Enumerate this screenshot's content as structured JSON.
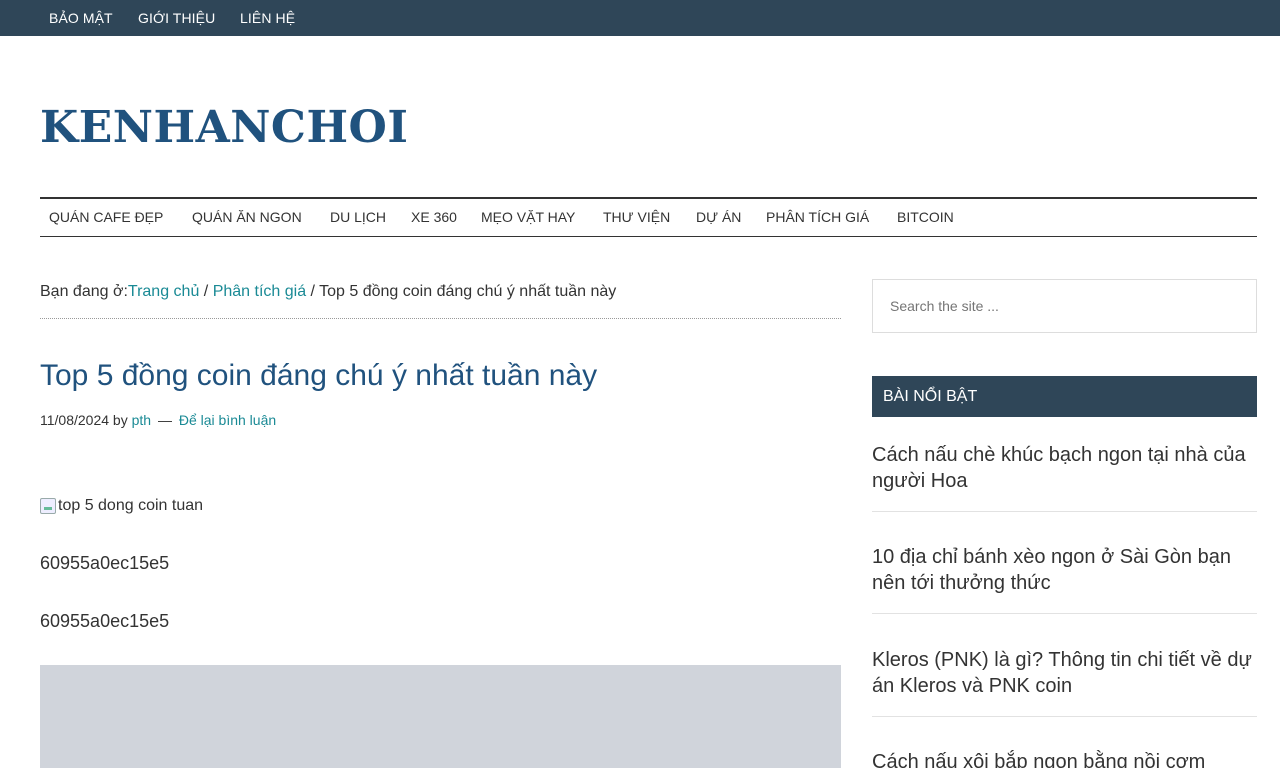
{
  "top_menu": [
    "BẢO MẬT",
    "GIỚI THIỆU",
    "LIÊN HỆ"
  ],
  "site_title": "KENHANCHOI",
  "main_menu": [
    "QUÁN CAFE ĐẸP",
    "QUÁN ĂN NGON",
    "DU LỊCH",
    "XE 360",
    "MẸO VẶT HAY",
    "THƯ VIỆN",
    "DỰ ÁN",
    "PHÂN TÍCH GIÁ",
    "BITCOIN"
  ],
  "breadcrumb": {
    "prefix": "Bạn đang ở:",
    "home": "Trang chủ",
    "sep1": " / ",
    "category": "Phân tích giá",
    "sep2": " / ",
    "current": "Top 5 đồng coin đáng chú ý nhất tuần này"
  },
  "post": {
    "title": "Top 5 đồng coin đáng chú ý nhất tuần này",
    "date": "11/08/2024",
    "by": "by",
    "author": "pth",
    "dash": "—",
    "comments_link": "Để lại bình luận",
    "image_alt": "top 5 dong coin tuan",
    "paragraphs": [
      "60955a0ec15e5",
      "60955a0ec15e5"
    ]
  },
  "sidebar": {
    "search_placeholder": "Search the site ...",
    "featured_title": "BÀI NỔI BẬT",
    "featured": [
      "Cách nấu chè khúc bạch ngon tại nhà của người Hoa",
      "10 địa chỉ bánh xèo ngon ở Sài Gòn bạn nên tới thưởng thức",
      "Kleros (PNK) là gì? Thông tin chi tiết về dự án Kleros và PNK coin",
      "Cách nấu xôi bắp ngon bằng nồi cơm"
    ]
  },
  "colors": {
    "bar": "#2f4658",
    "title_blue": "#20527e",
    "link_teal": "#1a8a95"
  }
}
